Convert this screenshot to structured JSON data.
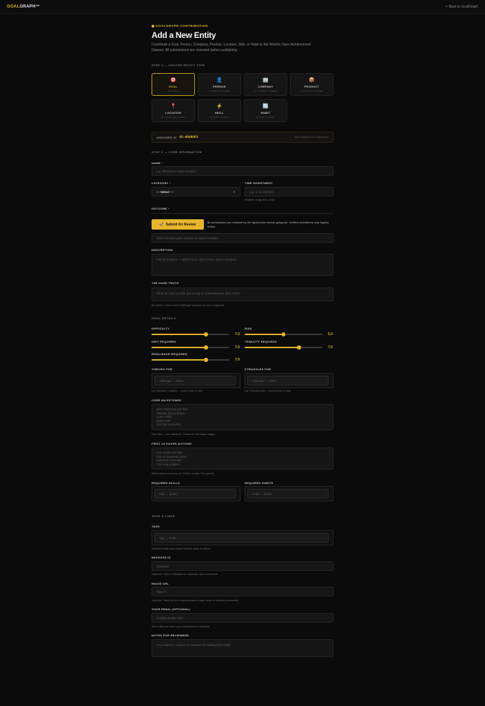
{
  "header": {
    "logo_accent": "GOAL",
    "logo_rest": "GRAPH™",
    "back_link": "⇦ Back to GoalGraph"
  },
  "hero": {
    "eyebrow": "GOALGRAPH CONTRIBUTION",
    "title": "Add a New Entity",
    "intro_line1": "Contribute a Goal, Person, Company, Product, Location, Skill, or Habit to the World's Open Achievement",
    "intro_line2": "Dataset. All submissions are reviewed before publishing."
  },
  "step1": {
    "title": "STEP 1 — CHOOSE ENTITY TYPE",
    "types": [
      {
        "name": "GOAL",
        "icon": "🎯",
        "count": "82 GOALS",
        "selected": true
      },
      {
        "name": "PERSON",
        "icon": "👤",
        "count": "87 PERSON NAMES",
        "selected": false
      },
      {
        "name": "COMPANY",
        "icon": "🏢",
        "count": "87 COMPANY NAMES",
        "selected": false
      },
      {
        "name": "PRODUCT",
        "icon": "📦",
        "count": "87 PRODUCT NAMES",
        "selected": false
      },
      {
        "name": "LOCATION",
        "icon": "📍",
        "count": "87 LOCATION NAMES",
        "selected": false
      },
      {
        "name": "SKILL",
        "icon": "⚡",
        "count": "87 SKILL NAMES",
        "selected": false
      },
      {
        "name": "HABIT",
        "icon": "🔄",
        "count": "87 HABIT NAMES",
        "selected": false
      }
    ]
  },
  "assigned": {
    "label": "ASSIGNED ID",
    "value": "GG-0000063",
    "note": "Auto-assigned on submission"
  },
  "step2": {
    "title": "STEP 2 — CORE INFORMATION",
    "name_label": "NAME",
    "name_placeholder": "e.g. Become a Data Scientist",
    "category_label": "CATEGORY",
    "category_value": "— Select —",
    "time_label": "TIME INVESTMENT",
    "time_placeholder": "e.g. 6–24 Months",
    "time_hint": "Realistic range (min–max)",
    "outcome_label": "OUTCOME",
    "short_desc_placeholder": "Short elevator pitch (shown in search results)",
    "description_label": "DESCRIPTION",
    "description_placeholder": "Full description — what this is, who it's for, what it involves",
    "hard_truth_label": "THE HARD TRUTH",
    "hard_truth_placeholder": "What do most people get wrong or underestimate about this?",
    "hard_truth_hint": "Be honest. Users trust GoalGraph because we don't sugarcoat."
  },
  "submit": {
    "label": "Submit for Review",
    "note": "All submissions are reviewed by the Spark| team before going live. Verified contributors may bypass review."
  },
  "goal_details": {
    "title": "GOAL DETAILS",
    "sliders": [
      {
        "label": "DIFFICULTY",
        "value": 7.0,
        "display": "7.0",
        "max": 10
      },
      {
        "label": "RISK",
        "value": 5.0,
        "display": "5.0",
        "max": 10
      },
      {
        "label": "GRIT REQUIRED",
        "value": 7.0,
        "display": "7.0",
        "max": 10
      },
      {
        "label": "TENACITY REQUIRED",
        "value": 7.0,
        "display": "7.0",
        "max": 10
      },
      {
        "label": "RESILIENCE REQUIRED",
        "value": 7.0,
        "display": "7.0",
        "max": 10
      }
    ],
    "thrives_label": "THRIVES FOR",
    "thrives_placeholder": "Add type → Enter",
    "thrives_hint": "e.g. Builders, Leaders — press Enter to add",
    "struggles_label": "STRUGGLES FOR",
    "struggles_placeholder": "Add type → Enter",
    "struggles_hint": "e.g. Perfectionists — press Enter to add",
    "milestones_label": "CORE MILESTONES",
    "milestones_lines": [
      "One milestone per line",
      "Validate the problem",
      "Learn skills",
      "Build MVP",
      "Get first customer"
    ],
    "milestones_hint": "Each line = one milestone. These are the major stages.",
    "first24_label": "FIRST 24 HOURS ACTIONS",
    "first24_lines": [
      "One action per line",
      "List 10 business ideas",
      "Interview 5 people",
      "Pick one problem"
    ],
    "first24_hint": "What should someone do TODAY to start? Be specific.",
    "skills_label": "REQUIRED SKILLS",
    "skills_placeholder": "Skill → Enter",
    "habits_label": "REQUIRED HABITS",
    "habits_placeholder": "Habit → Enter"
  },
  "tags_links": {
    "title": "TAGS & LINKS",
    "tags_label": "TAGS",
    "tags_placeholder": "Tag → Enter",
    "tags_hint": "Keywords that help people find this entity in search.",
    "wikidata_label": "WIKIDATA ID",
    "wikidata_placeholder": "Q312367",
    "wikidata_hint": "Optional. Links to Wikidata for automatic data enrichment.",
    "image_label": "IMAGE URL",
    "image_placeholder": "https://...",
    "image_hint": "Optional. Direct link to a representative image (must be publicly accessible).",
    "email_label": "YOUR EMAIL (OPTIONAL)",
    "email_placeholder": "you@example.com",
    "email_hint": "We'll notify you when your submission is reviewed.",
    "notes_label": "NOTES FOR REVIEWERS",
    "notes_placeholder": "Any sources, context, or reasons for adding this entity."
  },
  "colors": {
    "accent": "#e6b52c",
    "background": "#0b0b0b",
    "field": "#161616"
  }
}
